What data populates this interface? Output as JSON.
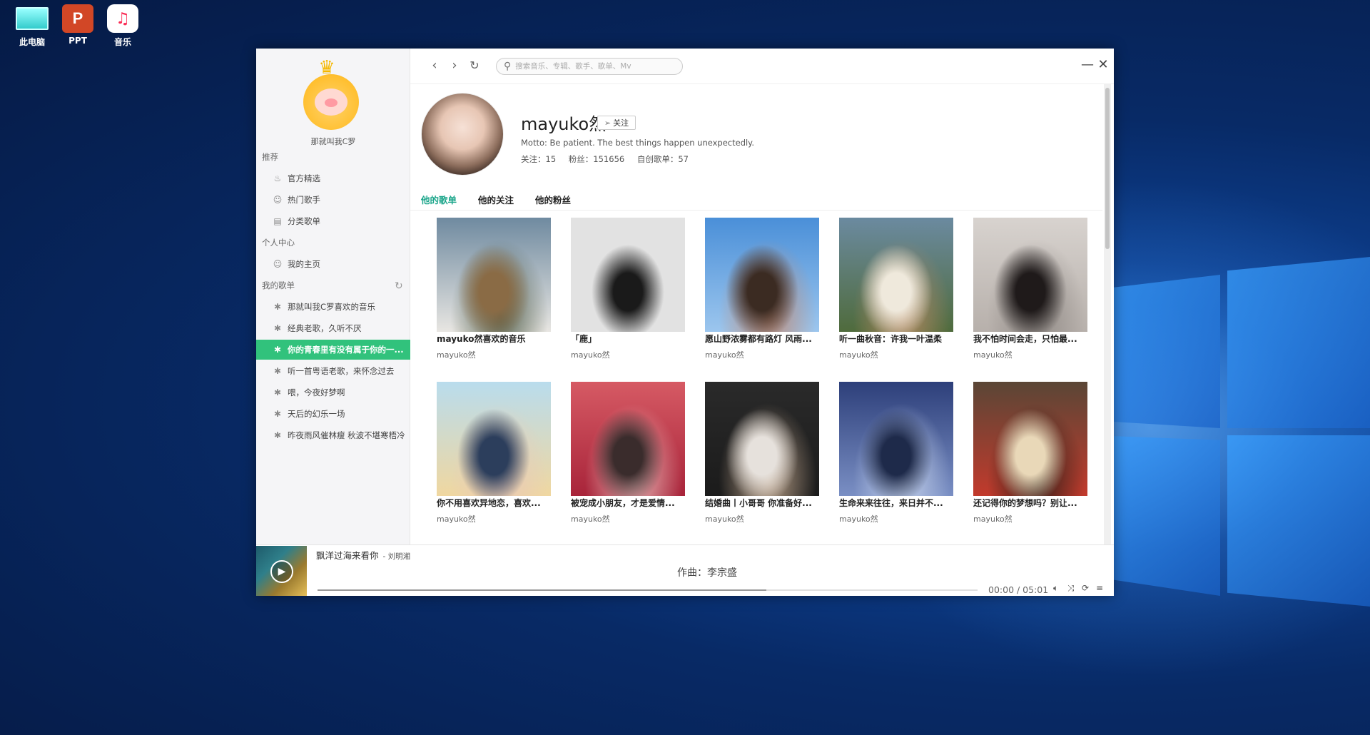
{
  "desktop": {
    "icons": [
      {
        "label": "此电脑",
        "icon": "computer-icon"
      },
      {
        "label": "PPT",
        "icon": "powerpoint-icon"
      },
      {
        "label": "音乐",
        "icon": "music-icon"
      }
    ]
  },
  "sidebar": {
    "username": "那就叫我C罗",
    "sections": {
      "recommend": "推荐",
      "personal": "个人中心",
      "playlists": "我的歌单"
    },
    "recommend_items": [
      {
        "label": "官方精选",
        "icon": "fire-icon"
      },
      {
        "label": "热门歌手",
        "icon": "person-icon"
      },
      {
        "label": "分类歌单",
        "icon": "category-icon"
      }
    ],
    "personal_items": [
      {
        "label": "我的主页",
        "icon": "smile-icon"
      }
    ],
    "playlist_items": [
      {
        "label": "那就叫我C罗喜欢的音乐",
        "icon": "palm-icon"
      },
      {
        "label": "经典老歌，久听不厌",
        "icon": "palm-icon"
      },
      {
        "label": "你的青春里有没有属于你的一...",
        "icon": "palm-icon",
        "active": true
      },
      {
        "label": "听一首粤语老歌，来怀念过去",
        "icon": "palm-icon"
      },
      {
        "label": "喂，今夜好梦啊",
        "icon": "palm-icon"
      },
      {
        "label": "天后的幻乐一场",
        "icon": "palm-icon"
      },
      {
        "label": "昨夜雨风催林瘦 秋波不堪寒梧冷",
        "icon": "palm-icon"
      }
    ]
  },
  "topbar": {
    "search_placeholder": "搜索音乐、专辑、歌手、歌单、Mv"
  },
  "profile": {
    "name": "mayuko然",
    "follow_label": "关注",
    "motto": "Motto:  Be patient. The best things happen unexpectedly.",
    "following": "关注：15",
    "fans": "粉丝：151656",
    "created": "自创歌单：57"
  },
  "tabs": [
    {
      "label": "他的歌单",
      "active": true
    },
    {
      "label": "他的关注"
    },
    {
      "label": "他的粉丝"
    }
  ],
  "playlists": [
    {
      "title": "mayuko然喜欢的音乐",
      "author": "mayuko然",
      "palette": [
        "#6f8aa0",
        "#e8e6e2",
        "#8a6b45",
        "#4f5c48"
      ]
    },
    {
      "title": "「鹿」",
      "author": "mayuko然",
      "palette": [
        "#e2e2e2",
        "#e2e2e2",
        "#1a1a1a",
        "#e2e2e2"
      ]
    },
    {
      "title": "愿山野浓雾都有路灯 风雨...",
      "author": "mayuko然",
      "palette": [
        "#4a8fd8",
        "#9cc6ee",
        "#3b2b22",
        "#c08a74"
      ]
    },
    {
      "title": "听一曲秋音：许我一叶温柔",
      "author": "mayuko然",
      "palette": [
        "#6b8aa0",
        "#4f6b3c",
        "#efe9dc",
        "#b78a64"
      ]
    },
    {
      "title": "我不怕时间会走，只怕最...",
      "author": "mayuko然",
      "palette": [
        "#d8d3cf",
        "#b7b0ab",
        "#1f1a1a",
        "#8f8985"
      ]
    },
    {
      "title": "你不用喜欢异地恋，喜欢...",
      "author": "mayuko然",
      "palette": [
        "#b9dced",
        "#f0d7a0",
        "#2c3e5c",
        "#e9c9b8"
      ]
    },
    {
      "title": "被宠成小朋友，才是爱情...",
      "author": "mayuko然",
      "palette": [
        "#d65a64",
        "#a8243a",
        "#3a2c2c",
        "#e8b8b8"
      ]
    },
    {
      "title": "结婚曲丨小哥哥 你准备好...",
      "author": "mayuko然",
      "palette": [
        "#2a2a2a",
        "#1b1b1b",
        "#e6e1dc",
        "#bfa58c"
      ]
    },
    {
      "title": "生命来来往往，来日并不...",
      "author": "mayuko然",
      "palette": [
        "#2d3f7a",
        "#7a8fc4",
        "#1e2a4a",
        "#c7d4ec"
      ]
    },
    {
      "title": "还记得你的梦想吗？别让...",
      "author": "mayuko然",
      "palette": [
        "#5a4636",
        "#c23a2c",
        "#e9d8b8",
        "#2a1e18"
      ]
    }
  ],
  "player": {
    "song": "飘洋过海来看你",
    "artist": "- 刘明湘",
    "lyric": "作曲：李宗盛",
    "time": "00:00 / 05:01",
    "progress": 0.68
  }
}
